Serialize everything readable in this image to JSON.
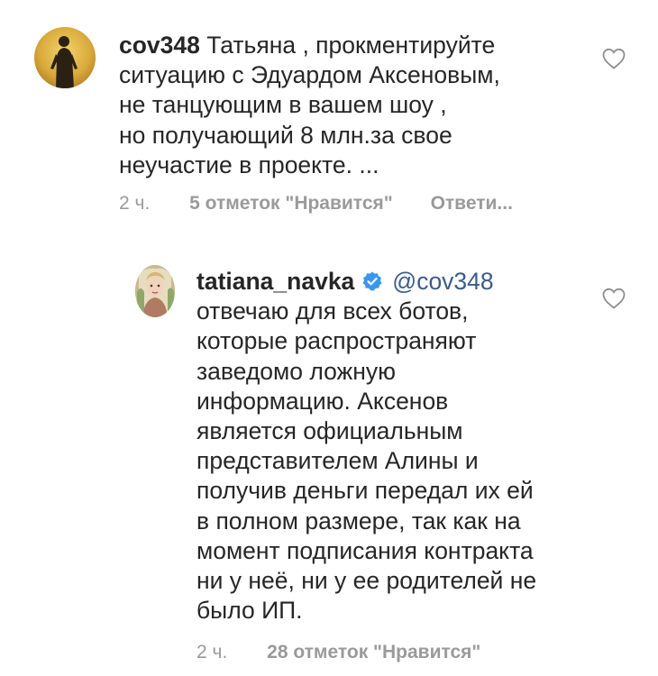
{
  "comments": [
    {
      "username": "cov348",
      "text": "Татьяна , прокментируйте ситуацию с Эдуардом Аксеновым, не танцующим в вашем шоу , но получающий 8 млн.за свое неучастие в проекте. ...",
      "lines": [
        "Татьяна , прокментируйте",
        "ситуацию с Эдуардом Аксеновым,",
        "не танцующим в вашем шоу ,",
        "но получающий 8 млн.за свое",
        "неучастие в проекте. ..."
      ],
      "time": "2 ч.",
      "likes": "5 отметок \"Нравится\"",
      "reply": "Ответи..."
    },
    {
      "username": "tatiana_navka",
      "verified": true,
      "mention": "@cov348",
      "lines": [
        "отвечаю для всех ботов,",
        "которые распространяют",
        "заведомо ложную",
        "информацию. Аксенов",
        "является официальным",
        "представителем Алины и",
        "получив деньги передал их ей",
        "в полном размере, так как на",
        "момент подписания контракта",
        "ни у неё, ни у ее родителей не",
        "было ИП."
      ],
      "time": "2 ч.",
      "likes": "28 отметок \"Нравится\""
    }
  ],
  "colors": {
    "text": "#262626",
    "meta": "#9a9a9a",
    "mention": "#3b5c8a",
    "verified": "#3897f0"
  },
  "icons": {
    "like": "heart-outline-icon",
    "verified": "verified-badge-icon"
  }
}
